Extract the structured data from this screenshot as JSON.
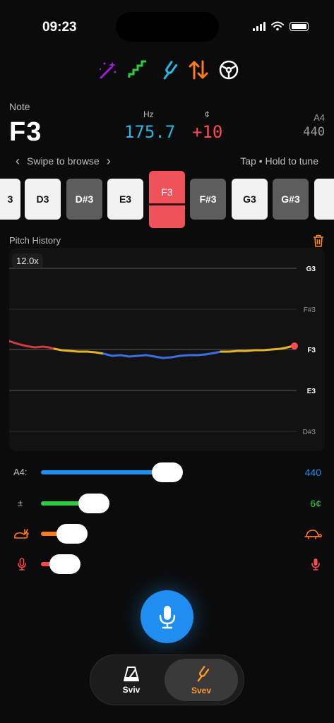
{
  "status": {
    "time": "09:23"
  },
  "toolbar": {
    "items": [
      {
        "icon": "magic-wand-icon",
        "color": "#a020d8"
      },
      {
        "icon": "stairs-icon",
        "color": "#2ecc40"
      },
      {
        "icon": "tuning-fork-icon",
        "color": "#29b6e6"
      },
      {
        "icon": "swap-arrows-icon",
        "color": "#ff7a1a"
      },
      {
        "icon": "steering-wheel-icon",
        "color": "#ffffff"
      }
    ]
  },
  "header": {
    "note_label": "Note",
    "note": "F3",
    "hz_label": "Hz",
    "hz": "175.7",
    "cents_label": "¢",
    "cents": "+10",
    "a4_label": "A4",
    "a4": "440"
  },
  "browse": {
    "prev": "‹",
    "text": "Swipe to browse",
    "next": "›",
    "hint": "Tap • Hold to tune"
  },
  "keys": [
    {
      "label": "3",
      "kind": "white"
    },
    {
      "label": "D3",
      "kind": "white"
    },
    {
      "label": "D#3",
      "kind": "dark"
    },
    {
      "label": "E3",
      "kind": "white"
    },
    {
      "label": "F3",
      "kind": "active"
    },
    {
      "label": "F#3",
      "kind": "dark"
    },
    {
      "label": "G3",
      "kind": "white"
    },
    {
      "label": "G#3",
      "kind": "dark"
    },
    {
      "label": "",
      "kind": "white"
    }
  ],
  "pitch_history": {
    "label": "Pitch History",
    "zoom": "12.0x",
    "notes": [
      {
        "label": "G3",
        "strong": true
      },
      {
        "label": "F#3",
        "strong": false
      },
      {
        "label": "F3",
        "strong": true
      },
      {
        "label": "E3",
        "strong": true
      },
      {
        "label": "D#3",
        "strong": false
      }
    ],
    "colors": {
      "sharp": "#d13b3b",
      "close": "#e3b528",
      "flat": "#3b6fe0",
      "marker": "#ff4a4f"
    }
  },
  "sliders": [
    {
      "name": "a4",
      "label": "A4:",
      "value": "440",
      "color": "#1f8ef0",
      "level": 0.41
    },
    {
      "name": "tolerance",
      "label": "±",
      "value": "6¢",
      "color": "#2ecc40",
      "level": 0.14
    },
    {
      "name": "speed",
      "label": "",
      "value": "",
      "color": "#ff7a1a",
      "level": 0.07,
      "left_icon": "rabbit-icon",
      "right_icon": "turtle-icon"
    },
    {
      "name": "sensitivity",
      "label": "",
      "value": "",
      "color": "#ff4a4f",
      "level": 0.05,
      "left_icon": "mic-small-icon",
      "right_icon": "mic-small-icon"
    }
  ],
  "tabs": [
    {
      "label": "Sviv",
      "icon": "metronome-icon",
      "selected": false
    },
    {
      "label": "Svev",
      "icon": "tuning-fork-icon",
      "selected": true,
      "color": "#ff9a2e"
    }
  ]
}
